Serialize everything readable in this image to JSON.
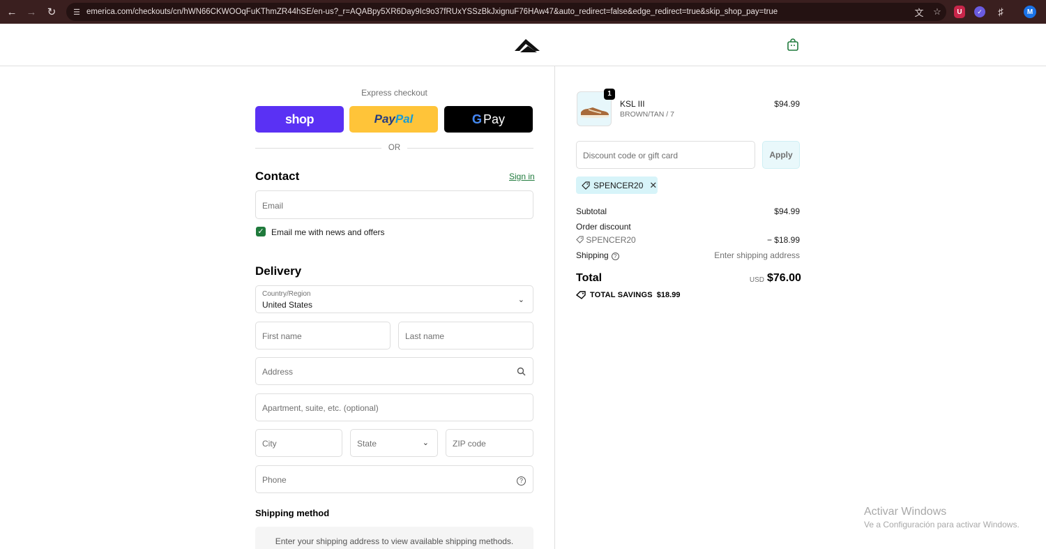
{
  "browser": {
    "url": "emerica.com/checkouts/cn/hWN66CKWOOqFuKThmZR44hSE/en-us?_r=AQABpy5XR6Day9Ic9o37fRUxYSSzBkJxignuF76HAw47&auto_redirect=false&edge_redirect=true&skip_shop_pay=true",
    "profile_initial": "M"
  },
  "express": {
    "title": "Express checkout",
    "shop_label": "shop",
    "paypal_part1": "Pay",
    "paypal_part2": "Pal",
    "gpay_label": "Pay",
    "or_label": "OR"
  },
  "contact": {
    "title": "Contact",
    "signin_label": "Sign in",
    "email_placeholder": "Email",
    "newsletter_label": "Email me with news and offers",
    "newsletter_checked": true
  },
  "delivery": {
    "title": "Delivery",
    "country_label": "Country/Region",
    "country_value": "United States",
    "first_name_placeholder": "First name",
    "last_name_placeholder": "Last name",
    "address_placeholder": "Address",
    "apartment_placeholder": "Apartment, suite, etc. (optional)",
    "city_placeholder": "City",
    "state_placeholder": "State",
    "zip_placeholder": "ZIP code",
    "phone_placeholder": "Phone"
  },
  "shipping_method": {
    "title": "Shipping method",
    "message": "Enter your shipping address to view available shipping methods."
  },
  "summary": {
    "item": {
      "quantity": "1",
      "name": "KSL III",
      "variant": "BROWN/TAN / 7",
      "price": "$94.99"
    },
    "discount_placeholder": "Discount code or gift card",
    "apply_label": "Apply",
    "applied_code": "SPENCER20",
    "subtotal_label": "Subtotal",
    "subtotal_value": "$94.99",
    "order_discount_label": "Order discount",
    "discount_code": "SPENCER20",
    "discount_value": "− $18.99",
    "shipping_label": "Shipping",
    "shipping_value": "Enter shipping address",
    "total_label": "Total",
    "total_currency": "USD",
    "total_value": "$76.00",
    "savings_label": "TOTAL SAVINGS",
    "savings_value": "$18.99"
  },
  "watermark": {
    "title": "Activar Windows",
    "subtitle": "Ve a Configuración para activar Windows."
  },
  "colors": {
    "accent_green": "#1f7a3c",
    "shop_purple": "#5a31f4",
    "paypal_yellow": "#ffc439",
    "chip_bg": "#d7f4f9"
  }
}
